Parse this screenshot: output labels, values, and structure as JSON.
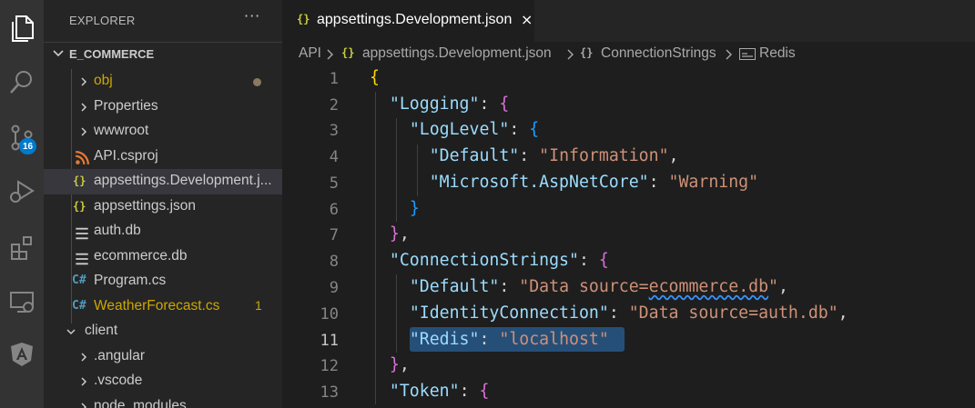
{
  "explorer": {
    "header": "EXPLORER",
    "more": "···",
    "section_title": "E_COMMERCE",
    "items": [
      {
        "label": "obj",
        "color": "#cca700",
        "icon": "chevron-right-icon",
        "modified": true
      },
      {
        "label": "Properties",
        "icon": "chevron-right-icon"
      },
      {
        "label": "wwwroot",
        "icon": "chevron-right-icon"
      },
      {
        "label": "API.csproj",
        "icon": "rss-icon"
      },
      {
        "label": "appsettings.Development.j...",
        "icon": "json-braces-icon",
        "selected": true
      },
      {
        "label": "appsettings.json",
        "icon": "json-braces-icon"
      },
      {
        "label": "auth.db",
        "icon": "lines-icon"
      },
      {
        "label": "ecommerce.db",
        "icon": "lines-icon"
      },
      {
        "label": "Program.cs",
        "icon": "csharp-icon"
      },
      {
        "label": "WeatherForecast.cs",
        "icon": "csharp-icon",
        "color": "#cca700",
        "problems": "1"
      },
      {
        "label": "client",
        "icon": "chevron-down-icon"
      },
      {
        "label": ".angular",
        "icon": "chevron-right-icon"
      },
      {
        "label": ".vscode",
        "icon": "chevron-right-icon"
      },
      {
        "label": "node_modules",
        "icon": "chevron-right-icon"
      }
    ]
  },
  "activity_bar": {
    "source_control_badge": "16",
    "icons": [
      "files-icon",
      "search-icon",
      "source-control-icon",
      "run-debug-icon",
      "extensions-icon",
      "remote-explorer-icon",
      "angular-icon"
    ]
  },
  "editor": {
    "tab": {
      "label": "appsettings.Development.json",
      "close": "×"
    },
    "breadcrumb": {
      "parts": [
        "API",
        "appsettings.Development.json",
        "ConnectionStrings",
        "Redis"
      ],
      "braces": "{}"
    },
    "current_line": "11"
  },
  "code_lines": [
    {
      "n": "1"
    },
    {
      "n": "2"
    },
    {
      "n": "3"
    },
    {
      "n": "4"
    },
    {
      "n": "5"
    },
    {
      "n": "6"
    },
    {
      "n": "7"
    },
    {
      "n": "8"
    },
    {
      "n": "9"
    },
    {
      "n": "10"
    },
    {
      "n": "11"
    },
    {
      "n": "12"
    },
    {
      "n": "13"
    }
  ],
  "code": {
    "open": "{",
    "logging_key": "\"Logging\"",
    "loglevel_key": "\"LogLevel\"",
    "default_key": "\"Default\"",
    "information_val": "\"Information\"",
    "ms_key": "\"Microsoft.AspNetCore\"",
    "warning_val": "\"Warning\"",
    "connstr_key": "\"ConnectionStrings\"",
    "data_source_prefix": "\"Data source=",
    "data_source_file": "ecommerce.db",
    "data_source_suffix": "\"",
    "identity_key": "\"IdentityConnection\"",
    "identity_val": "\"Data source=auth.db\"",
    "redis_key": "\"Redis\"",
    "redis_val": "\"localhost\"",
    "token_key": "\"Token\""
  },
  "colors": {
    "key": "#9cdcfe",
    "string": "#ce9178",
    "bracket_level1": "#ffd700",
    "bracket_level2": "#da70d6",
    "bracket_level3": "#179fff",
    "selection": "#264f78",
    "accent": "#007acc"
  }
}
